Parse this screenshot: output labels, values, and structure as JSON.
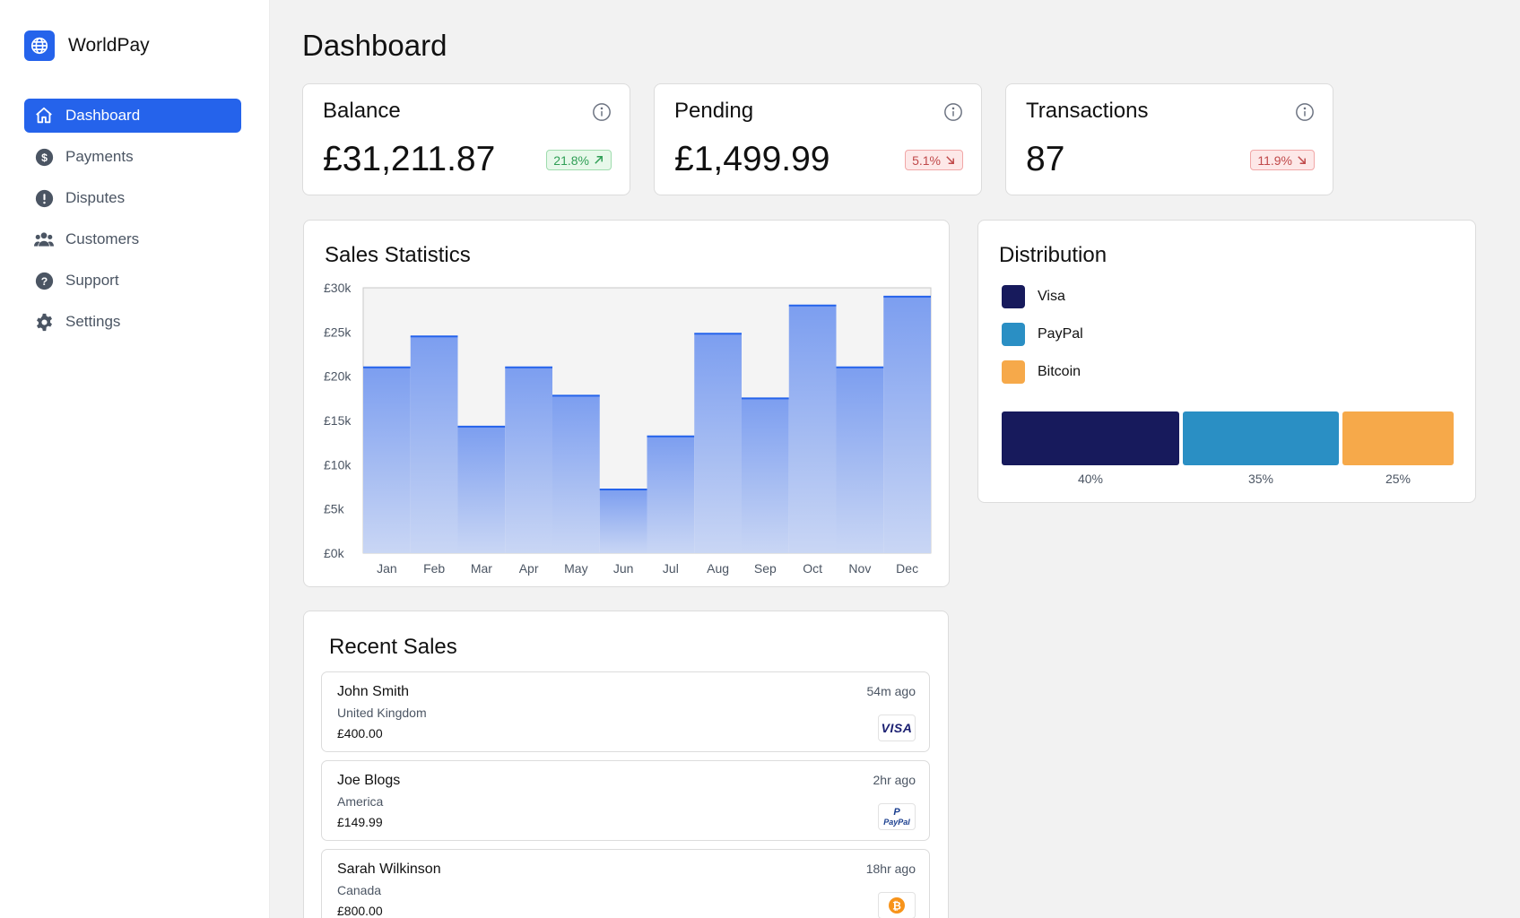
{
  "brand": {
    "name": "WorldPay",
    "accent": "#2563eb"
  },
  "sidebar": {
    "items": [
      {
        "label": "Dashboard",
        "icon": "home-icon",
        "active": true
      },
      {
        "label": "Payments",
        "icon": "dollar-circle-icon"
      },
      {
        "label": "Disputes",
        "icon": "alert-circle-icon"
      },
      {
        "label": "Customers",
        "icon": "users-icon"
      },
      {
        "label": "Support",
        "icon": "question-circle-icon"
      },
      {
        "label": "Settings",
        "icon": "gear-icon"
      }
    ]
  },
  "page": {
    "title": "Dashboard"
  },
  "stats": [
    {
      "label": "Balance",
      "value": "£31,211.87",
      "change": "21.8%",
      "direction": "up"
    },
    {
      "label": "Pending",
      "value": "£1,499.99",
      "change": "5.1%",
      "direction": "down"
    },
    {
      "label": "Transactions",
      "value": "87",
      "change": "11.9%",
      "direction": "down"
    }
  ],
  "sales_statistics": {
    "title": "Sales Statistics"
  },
  "chart_data": {
    "type": "bar",
    "title": "Sales Statistics",
    "categories": [
      "Jan",
      "Feb",
      "Mar",
      "Apr",
      "May",
      "Jun",
      "Jul",
      "Aug",
      "Sep",
      "Oct",
      "Nov",
      "Dec"
    ],
    "values": [
      21000,
      24500,
      14300,
      21000,
      17800,
      7200,
      13200,
      24800,
      17500,
      28000,
      21000,
      29000
    ],
    "yticks": [
      "£0k",
      "£5k",
      "£10k",
      "£15k",
      "£20k",
      "£25k",
      "£30k"
    ],
    "ylim": [
      0,
      30000
    ],
    "color": "#2563eb",
    "grid": false
  },
  "distribution": {
    "title": "Distribution",
    "items": [
      {
        "label": "Visa",
        "percent": 40,
        "percent_label": "40%",
        "color": "#171a5c"
      },
      {
        "label": "PayPal",
        "percent": 35,
        "percent_label": "35%",
        "color": "#2a8fc4"
      },
      {
        "label": "Bitcoin",
        "percent": 25,
        "percent_label": "25%",
        "color": "#f6a94a"
      }
    ]
  },
  "recent_sales": {
    "title": "Recent Sales",
    "items": [
      {
        "name": "John Smith",
        "country": "United Kingdom",
        "amount": "£400.00",
        "time": "54m ago",
        "method": "visa-icon",
        "method_text": "VISA"
      },
      {
        "name": "Joe Blogs",
        "country": "America",
        "amount": "£149.99",
        "time": "2hr ago",
        "method": "paypal-icon",
        "method_text": "PayPal"
      },
      {
        "name": "Sarah Wilkinson",
        "country": "Canada",
        "amount": "£800.00",
        "time": "18hr ago",
        "method": "bitcoin-icon"
      }
    ]
  }
}
